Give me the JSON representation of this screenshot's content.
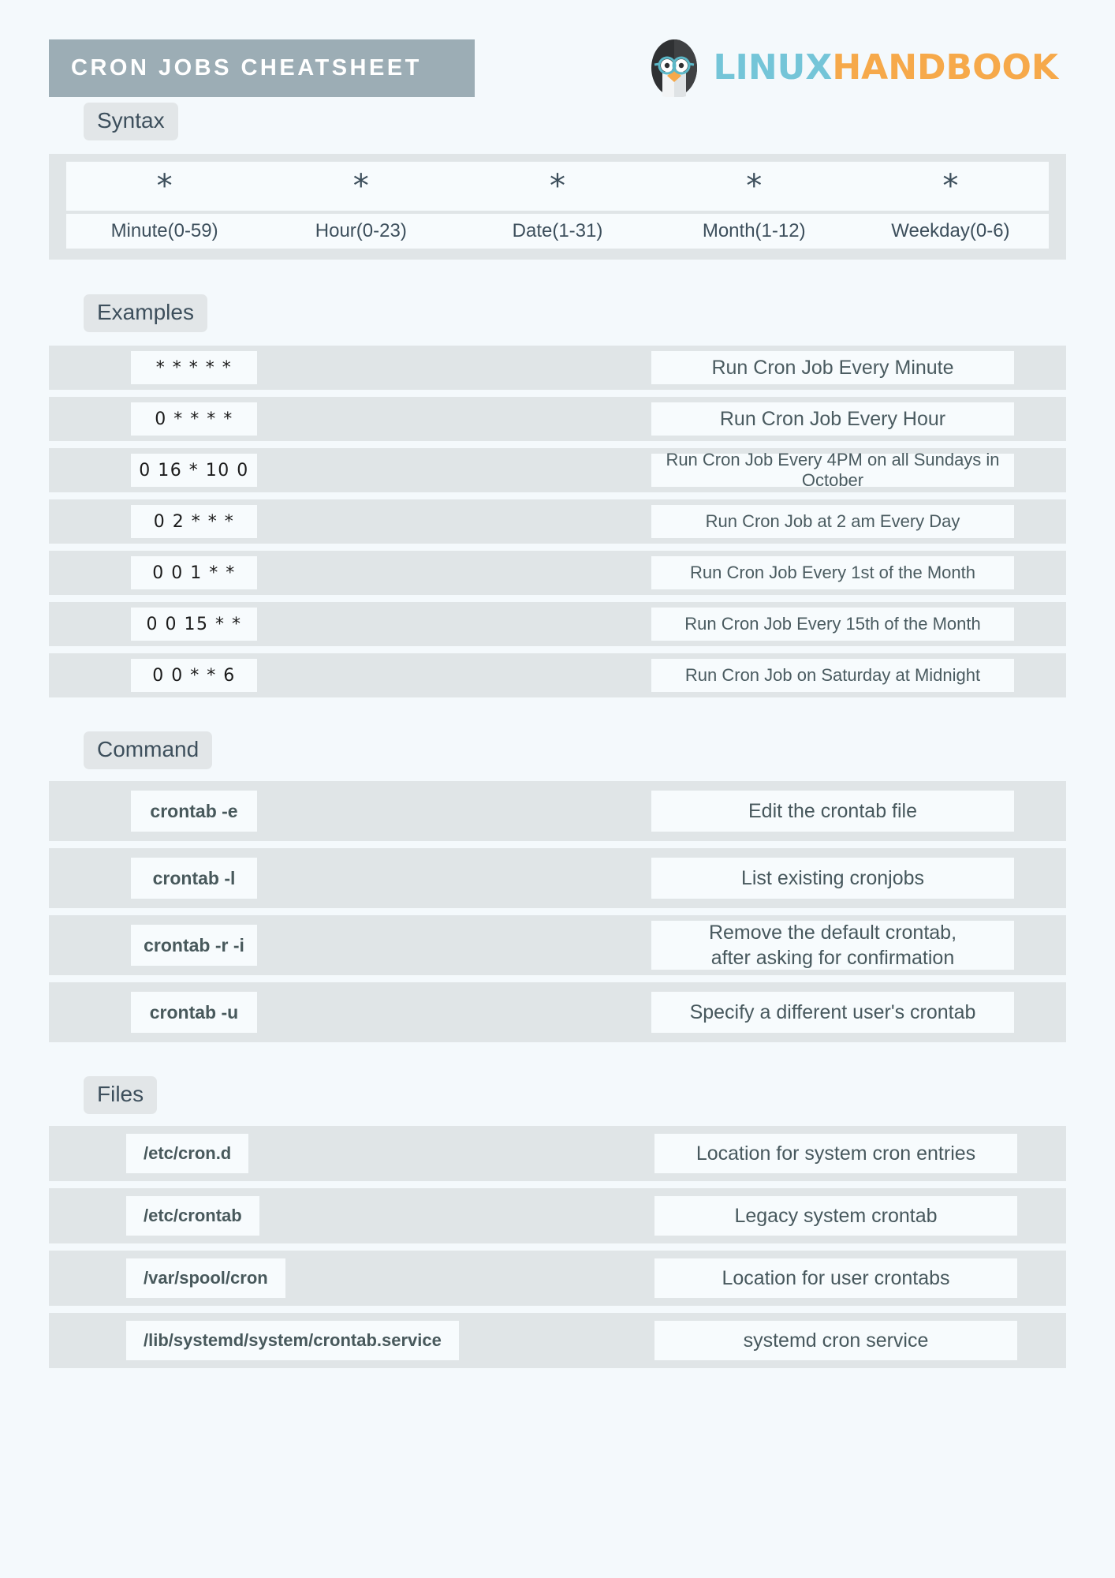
{
  "header": {
    "title": "CRON JOBS CHEATSHEET",
    "brand_first": "LINUX",
    "brand_second": "HANDBOOK",
    "title_bg": "#9cadb5",
    "brand_first_color": "#74c5d8",
    "brand_second_color": "#f6a94a"
  },
  "syntax": {
    "label": "Syntax",
    "fields": [
      {
        "star": "*",
        "label": "Minute(0-59)"
      },
      {
        "star": "*",
        "label": "Hour(0-23)"
      },
      {
        "star": "*",
        "label": "Date(1-31)"
      },
      {
        "star": "*",
        "label": "Month(1-12)"
      },
      {
        "star": "*",
        "label": "Weekday(0-6)"
      }
    ]
  },
  "examples": {
    "label": "Examples",
    "rows": [
      {
        "code": "* * * * *",
        "desc": "Run Cron Job Every Minute",
        "big": true
      },
      {
        "code": "0 * * * *",
        "desc": "Run Cron Job Every Hour",
        "big": true
      },
      {
        "code": "0 16 * 10 0",
        "desc": "Run Cron Job Every 4PM on all Sundays in October",
        "big": false
      },
      {
        "code": "0 2 * * *",
        "desc": "Run Cron Job at 2 am Every Day",
        "big": false
      },
      {
        "code": "0 0 1 * *",
        "desc": "Run Cron Job Every 1st of the Month",
        "big": false
      },
      {
        "code": "0 0 15 * *",
        "desc": "Run Cron Job Every 15th of the Month",
        "big": false
      },
      {
        "code": "0 0 * * 6",
        "desc": "Run Cron Job on Saturday at Midnight",
        "big": false
      }
    ]
  },
  "command": {
    "label": "Command",
    "rows": [
      {
        "code": "crontab -e",
        "desc": "Edit the crontab file",
        "desc2": ""
      },
      {
        "code": "crontab -l",
        "desc": "List existing cronjobs",
        "desc2": ""
      },
      {
        "code": "crontab -r -i",
        "desc": "Remove the default crontab,",
        "desc2": "after asking for confirmation"
      },
      {
        "code": "crontab -u",
        "desc": "Specify a different user's crontab",
        "desc2": ""
      }
    ]
  },
  "files": {
    "label": "Files",
    "rows": [
      {
        "code": "/etc/cron.d",
        "desc": "Location for system cron entries"
      },
      {
        "code": "/etc/crontab",
        "desc": "Legacy system crontab"
      },
      {
        "code": "/var/spool/cron",
        "desc": "Location for user crontabs"
      },
      {
        "code": "/lib/systemd/system/crontab.service",
        "desc": "systemd cron service"
      }
    ]
  }
}
